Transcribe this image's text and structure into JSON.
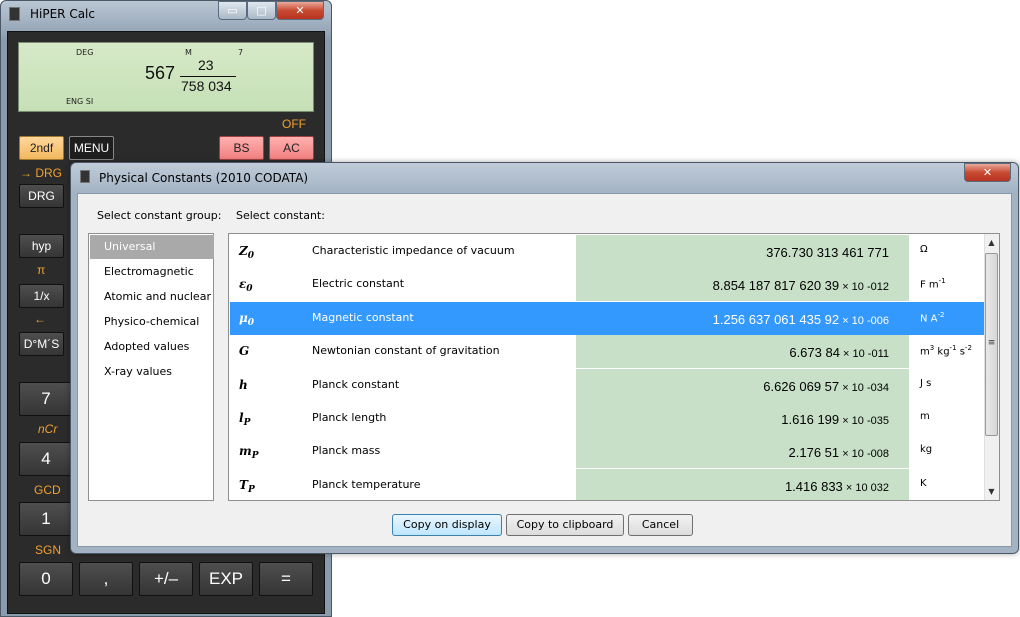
{
  "calc": {
    "title": "HiPER Calc",
    "window_buttons": {
      "minimize": "▭",
      "maximize": "□",
      "close": "✕"
    },
    "display": {
      "annunciator_mode": "DEG",
      "annunciator_memory": "M",
      "annunciator_digit": "7",
      "annunciator_format": "ENG SI",
      "integer": "567",
      "numerator": "23",
      "denominator": "758 034"
    },
    "off_label": "OFF",
    "keys": {
      "k2ndf": "2ndf",
      "menu": "MENU",
      "bs": "BS",
      "ac": "AC",
      "drg_shift": "→ DRG",
      "drg": "DRG",
      "hyp": "hyp",
      "pi_shift": "π",
      "reciprocal": "1/x",
      "arrow_shift": "←",
      "dms": "D°M´S",
      "seven": "7",
      "ncr_shift": "nCr",
      "four": "4",
      "gcd_shift": "GCD",
      "one": "1",
      "sgn_shift": "SGN",
      "zero": "0",
      "comma": ",",
      "plusminus": "+/–",
      "exp": "EXP",
      "equals": "="
    }
  },
  "dialog": {
    "title": "Physical Constants (2010 CODATA)",
    "close": "✕",
    "group_label": "Select constant group:",
    "constant_label": "Select constant:",
    "groups": [
      "Universal",
      "Electromagnetic",
      "Atomic and nuclear",
      "Physico-chemical",
      "Adopted values",
      "X-ray values"
    ],
    "selected_group": "Universal",
    "constants": [
      {
        "sym": "Z",
        "sub": "0",
        "name": "Characteristic impedance of vacuum",
        "mant": "376.730 313 461 771",
        "times": "",
        "exp": "",
        "unit": "Ω",
        "unit_sup": "",
        "unit_rest": ""
      },
      {
        "sym": "ε",
        "sub": "0",
        "name": "Electric constant",
        "mant": "8.854 187 817 620 39",
        "times": " × 10",
        "exp": " -012",
        "unit": "F m",
        "unit_sup": "-1",
        "unit_rest": ""
      },
      {
        "sym": "μ",
        "sub": "0",
        "name": "Magnetic constant",
        "mant": "1.256 637 061 435 92",
        "times": " × 10",
        "exp": " -006",
        "unit": "N A",
        "unit_sup": "-2",
        "unit_rest": ""
      },
      {
        "sym": "G",
        "sub": "",
        "name": "Newtonian constant of gravitation",
        "mant": "6.673 84",
        "times": " × 10",
        "exp": " -011",
        "unit": "m",
        "unit_sup": "3",
        "unit_rest": " kg-1 s-2"
      },
      {
        "sym": "h",
        "sub": "",
        "name": "Planck constant",
        "mant": "6.626 069 57",
        "times": " × 10",
        "exp": " -034",
        "unit": "J s",
        "unit_sup": "",
        "unit_rest": ""
      },
      {
        "sym": "l",
        "sub": "P",
        "name": "Planck length",
        "mant": "1.616 199",
        "times": " × 10",
        "exp": " -035",
        "unit": "m",
        "unit_sup": "",
        "unit_rest": ""
      },
      {
        "sym": "m",
        "sub": "P",
        "name": "Planck mass",
        "mant": "2.176 51",
        "times": " × 10",
        "exp": " -008",
        "unit": "kg",
        "unit_sup": "",
        "unit_rest": ""
      },
      {
        "sym": "T",
        "sub": "P",
        "name": "Planck temperature",
        "mant": "1.416 833",
        "times": " × 10",
        "exp": "  032",
        "unit": "K",
        "unit_sup": "",
        "unit_rest": ""
      }
    ],
    "selected_constant": "Magnetic constant",
    "buttons": {
      "copy_display": "Copy on display",
      "copy_clipboard": "Copy to clipboard",
      "cancel": "Cancel"
    }
  }
}
